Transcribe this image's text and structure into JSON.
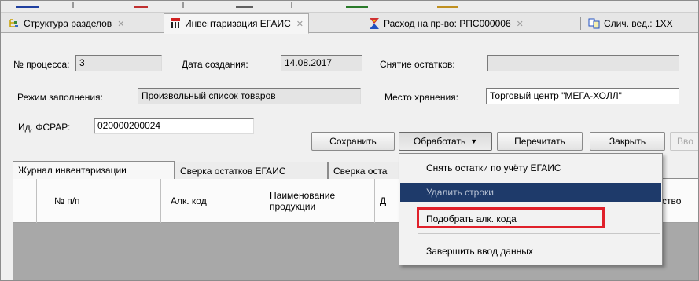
{
  "tabs": [
    {
      "label": "Структура разделов"
    },
    {
      "label": "Инвентаризация ЕГАИС"
    },
    {
      "label": "Расход на пр-во: РПС000006"
    },
    {
      "label": "Слич. вед.: 1XX"
    }
  ],
  "form": {
    "process_no_label": "№ процесса:",
    "process_no_value": "3",
    "created_label": "Дата создания:",
    "created_value": "14.08.2017",
    "remains_label": "Снятие остатков:",
    "remains_value": "",
    "mode_label": "Режим заполнения:",
    "mode_value": "Произвольный список товаров",
    "storage_label": "Место хранения:",
    "storage_value": "Торговый центр \"МЕГА-ХОЛЛ\"",
    "fsrar_label": "Ид. ФСРАР:",
    "fsrar_value": "020000200024"
  },
  "buttons": {
    "save": "Сохранить",
    "process": "Обработать",
    "reread": "Перечитать",
    "close": "Закрыть",
    "input": "Вво"
  },
  "inner_tabs": [
    {
      "label": "Журнал инвентаризации"
    },
    {
      "label": "Сверка остатков ЕГАИС"
    },
    {
      "label": "Сверка оста"
    }
  ],
  "grid": {
    "columns": [
      {
        "label": "№ п/п"
      },
      {
        "label": "Алк. код"
      },
      {
        "label": "Наименование продукции"
      },
      {
        "label": "Д"
      },
      {
        "label": "ство"
      }
    ]
  },
  "menu": {
    "items": [
      {
        "label": "Снять остатки по учёту ЕГАИС"
      },
      {
        "label": "Удалить строки"
      },
      {
        "label": "Подобрать алк. кода"
      },
      {
        "label": "Завершить ввод данных"
      }
    ]
  },
  "colors": {
    "menu_highlight": "#1e3a6a",
    "annotation_box": "#e0202a"
  }
}
